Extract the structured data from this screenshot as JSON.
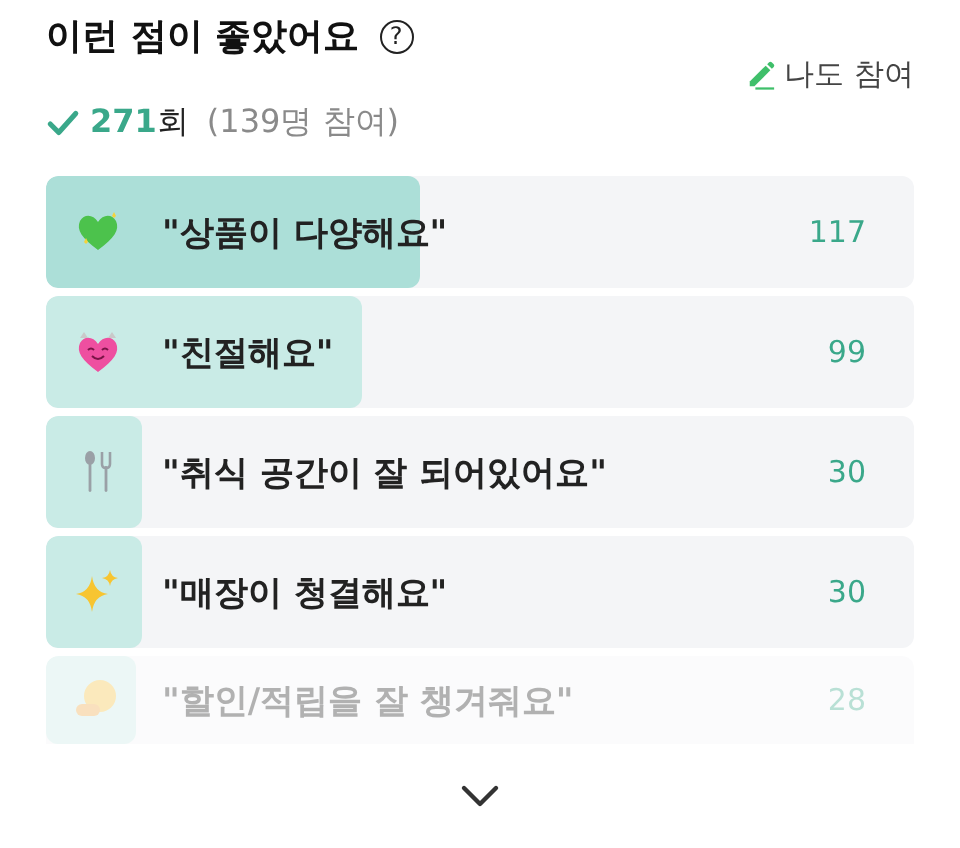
{
  "header": {
    "title": "이런 점이 좋았어요",
    "help_icon": "?",
    "join_label": "나도 참여"
  },
  "summary": {
    "count": "271",
    "count_unit": "회",
    "participants": "(139명 참여)"
  },
  "items": [
    {
      "label": "\"상품이 다양해요\"",
      "count": "117",
      "level": 0.43,
      "faded": false
    },
    {
      "label": "\"친절해요\"",
      "count": "99",
      "level": 0.365,
      "faded": false
    },
    {
      "label": "\"취식 공간이 잘 되어있어요\"",
      "count": "30",
      "level": 0.11,
      "faded": false
    },
    {
      "label": "\"매장이 청결해요\"",
      "count": "30",
      "level": 0.11,
      "faded": false
    },
    {
      "label": "\"할인/적립을 잘 챙겨줘요\"",
      "count": "28",
      "level": 0.103,
      "faded": true
    }
  ]
}
